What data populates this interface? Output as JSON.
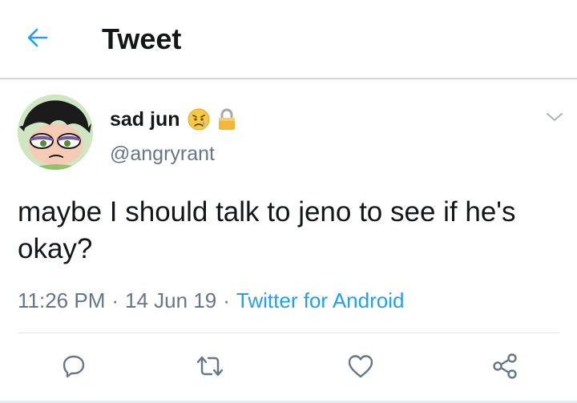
{
  "header": {
    "title": "Tweet",
    "back_icon": "arrow-left-icon",
    "accent": "#1da1f2"
  },
  "tweet": {
    "display_name": "sad jun",
    "name_emojis": [
      "worried-tear-face-icon",
      "lock-icon"
    ],
    "handle": "@angryrant",
    "text": "maybe I should talk to jeno to see if he's okay?",
    "time": "11:26 PM",
    "date": "14 Jun 19",
    "separator": "·",
    "source": "Twitter for Android"
  },
  "actions": [
    {
      "name": "reply",
      "icon": "reply-icon"
    },
    {
      "name": "retweet",
      "icon": "retweet-icon"
    },
    {
      "name": "like",
      "icon": "heart-icon"
    },
    {
      "name": "share",
      "icon": "share-icon"
    }
  ],
  "colors": {
    "text_primary": "#14171a",
    "text_secondary": "#657786",
    "link": "#1da1f2",
    "icon_gray": "#657786"
  }
}
